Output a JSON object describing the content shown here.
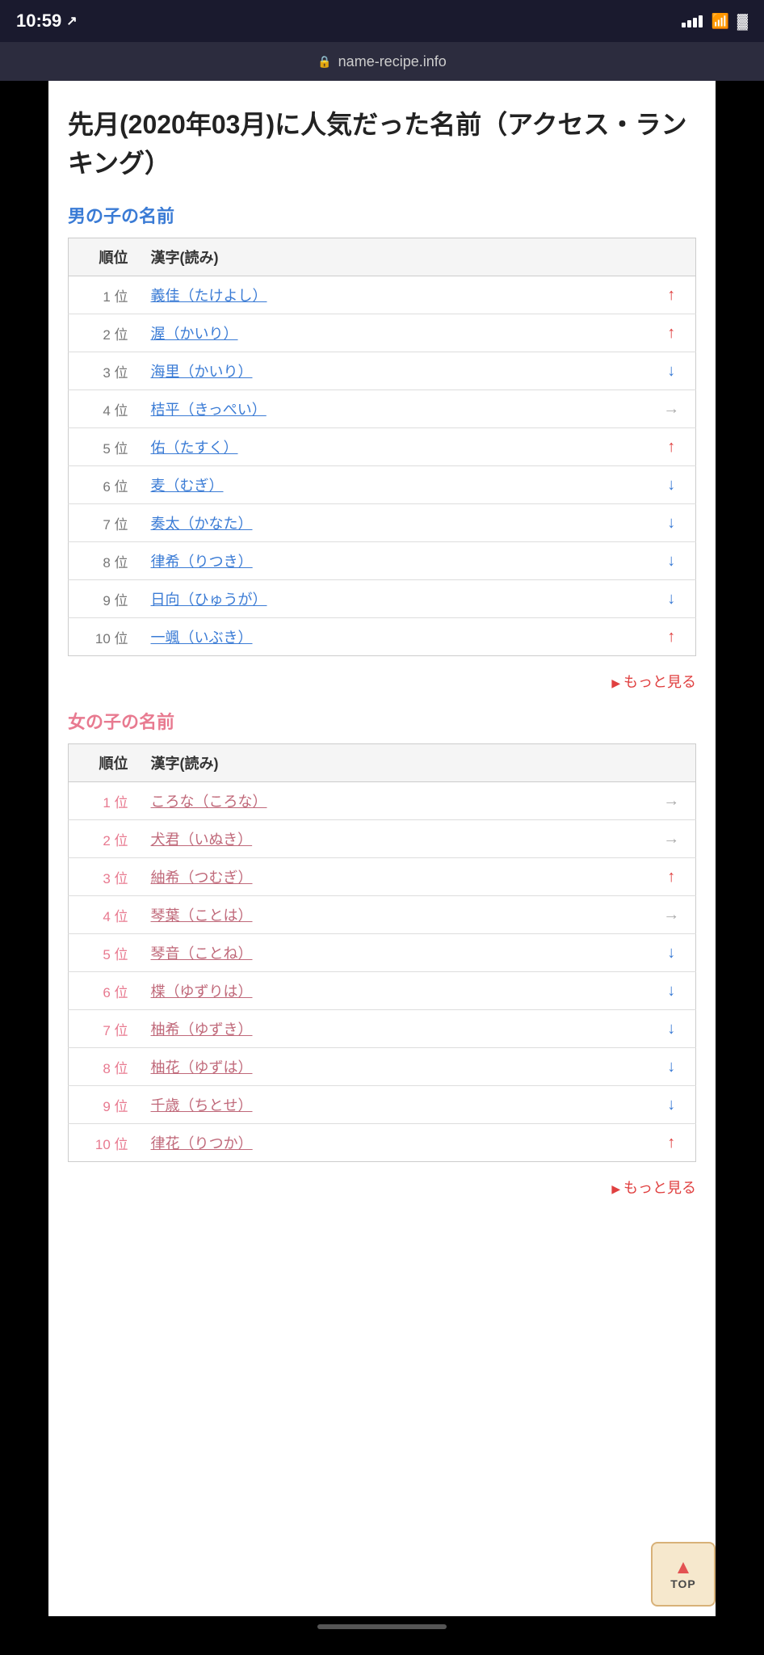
{
  "statusBar": {
    "time": "10:59",
    "locationIcon": "↗"
  },
  "browserBar": {
    "url": "name-recipe.info",
    "lockLabel": "🔒"
  },
  "pageTitle": "先月(2020年03月)に人気だった名前（アクセス・ランキング）",
  "boys": {
    "heading": "男の子の名前",
    "tableHeaders": [
      "順位",
      "漢字(読み)",
      ""
    ],
    "rows": [
      {
        "rank": "1 位",
        "name": "義佳（たけよし）",
        "trend": "up"
      },
      {
        "rank": "2 位",
        "name": "渥（かいり）",
        "trend": "up"
      },
      {
        "rank": "3 位",
        "name": "海里（かいり）",
        "trend": "down"
      },
      {
        "rank": "4 位",
        "name": "桔平（きっぺい）",
        "trend": "right"
      },
      {
        "rank": "5 位",
        "name": "佑（たすく）",
        "trend": "up"
      },
      {
        "rank": "6 位",
        "name": "麦（むぎ）",
        "trend": "down"
      },
      {
        "rank": "7 位",
        "name": "奏太（かなた）",
        "trend": "down"
      },
      {
        "rank": "8 位",
        "name": "律希（りつき）",
        "trend": "down"
      },
      {
        "rank": "9 位",
        "name": "日向（ひゅうが）",
        "trend": "down"
      },
      {
        "rank": "10 位",
        "name": "一颯（いぶき）",
        "trend": "up"
      }
    ],
    "moreLink": "もっと見る"
  },
  "girls": {
    "heading": "女の子の名前",
    "tableHeaders": [
      "順位",
      "漢字(読み)",
      ""
    ],
    "rows": [
      {
        "rank": "1 位",
        "name": "ころな（ころな）",
        "trend": "right"
      },
      {
        "rank": "2 位",
        "name": "犬君（いぬき）",
        "trend": "right"
      },
      {
        "rank": "3 位",
        "name": "紬希（つむぎ）",
        "trend": "up"
      },
      {
        "rank": "4 位",
        "name": "琴葉（ことは）",
        "trend": "right"
      },
      {
        "rank": "5 位",
        "name": "琴音（ことね）",
        "trend": "down"
      },
      {
        "rank": "6 位",
        "name": "楪（ゆずりは）",
        "trend": "down"
      },
      {
        "rank": "7 位",
        "name": "柚希（ゆずき）",
        "trend": "down"
      },
      {
        "rank": "8 位",
        "name": "柚花（ゆずは）",
        "trend": "down"
      },
      {
        "rank": "9 位",
        "name": "千歳（ちとせ）",
        "trend": "down"
      },
      {
        "rank": "10 位",
        "name": "律花（りつか）",
        "trend": "up"
      }
    ],
    "moreLink": "もっと見る"
  },
  "topButton": {
    "label": "TOP"
  }
}
